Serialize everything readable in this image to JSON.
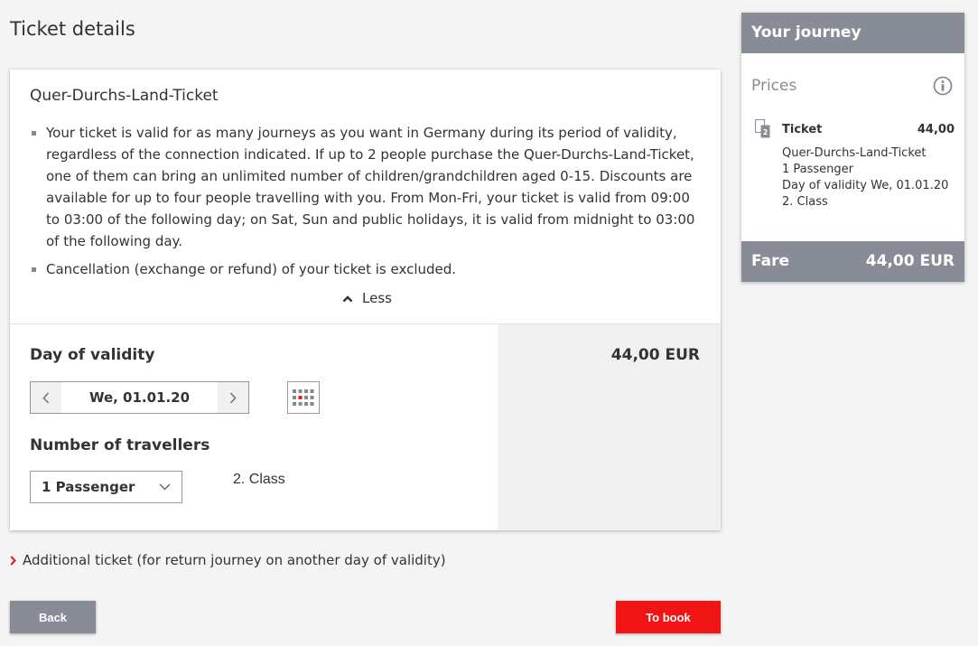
{
  "page": {
    "title": "Ticket details"
  },
  "ticket": {
    "name": "Quer-Durchs-Land-Ticket",
    "conditions": [
      "Your ticket is valid for as many journeys as you want in Germany during its period of validity, regardless of the connection indicated. If up to 2 people purchase the Quer-Durchs-Land-Ticket, one of them can bring an unlimited number of children/grandchildren aged 0-15. Discounts are available for up to four people travelling with you. From Mon-Fri, your ticket is valid from 09:00 to 03:00 of the following day; on Sat, Sun and public holidays, it is valid from midnight to 03:00 of the following day.",
      "Cancellation (exchange or refund) of your ticket is excluded."
    ],
    "less_label": "Less",
    "day_of_validity_label": "Day of validity",
    "date_value": "We, 01.01.20",
    "travellers_label": "Number of travellers",
    "passenger_value": "1 Passenger",
    "class_value": "2. Class",
    "price": "44,00 EUR"
  },
  "additional_ticket_label": "Additional ticket (for return journey on another day of validity)",
  "buttons": {
    "back": "Back",
    "book": "To book"
  },
  "journey": {
    "header": "Your journey",
    "prices_label": "Prices",
    "ticket_label": "Ticket",
    "ticket_price": "44,00",
    "ticket_icon_label": "2",
    "details": [
      "Quer-Durchs-Land-Ticket",
      "1 Passenger",
      "Day of validity We, 01.01.20",
      "2. Class"
    ],
    "fare_label": "Fare",
    "fare_value": "44,00 EUR"
  },
  "icons": {
    "less": "chevron-up-icon",
    "date_prev": "chevron-left-icon",
    "date_next": "chevron-right-icon",
    "calendar": "calendar-icon",
    "dropdown": "chevron-down-icon",
    "additional": "chevron-right-icon",
    "info": "info-icon",
    "ticket": "ticket-icon"
  },
  "colors": {
    "accent_red": "#f01414",
    "panel_grey": "#878c96",
    "background": "#f4f4f4"
  }
}
